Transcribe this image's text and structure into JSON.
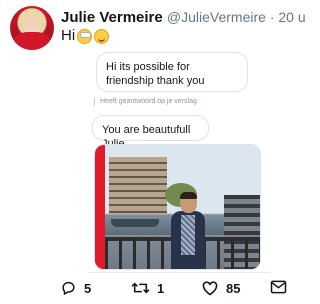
{
  "author": {
    "display_name": "Julie Vermeire",
    "handle": "@JulieVermeire",
    "separator": " · ",
    "time": "20 u"
  },
  "tweet": {
    "text": "Hi",
    "emojis": [
      "grimacing-face-emoji",
      "grinning-sweat-emoji"
    ]
  },
  "screenshot": {
    "message_1": "Hi its possible for friendship thank you",
    "reply_note": "Heeft geantwoord op je verslag",
    "message_2": "You are beautufull Julie"
  },
  "actions": {
    "replies": "5",
    "retweets": "1",
    "likes": "85"
  },
  "colors": {
    "text": "#14171a",
    "secondary": "#657786",
    "border": "#dfe3e6"
  }
}
